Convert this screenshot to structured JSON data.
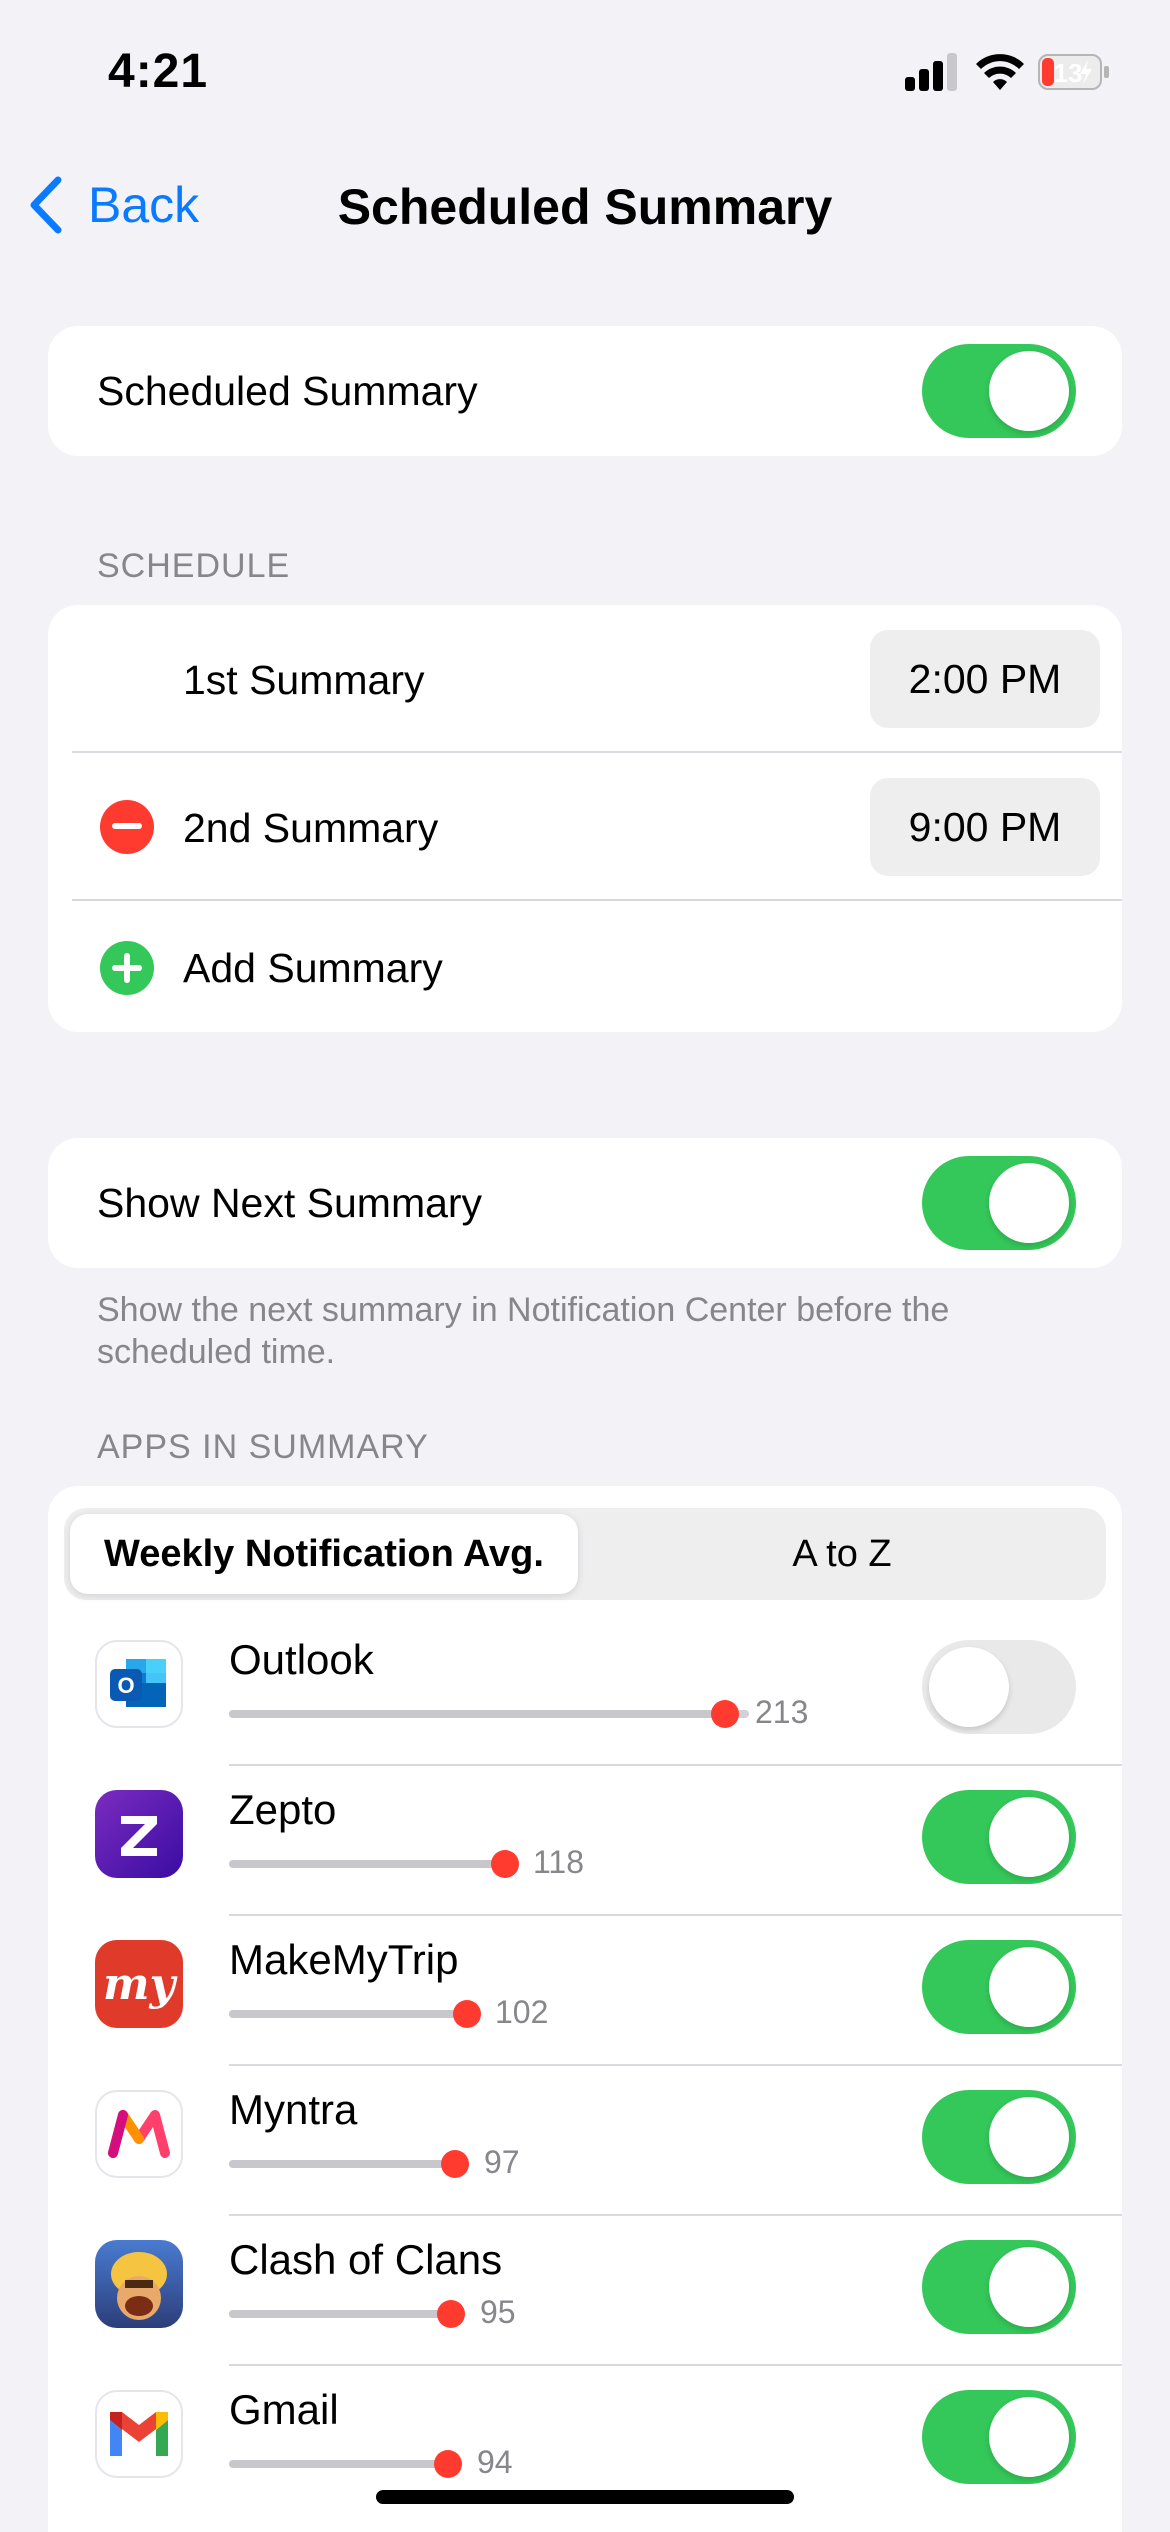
{
  "status_bar": {
    "time": "4:21",
    "battery_level": "13"
  },
  "nav": {
    "back_label": "Back",
    "title": "Scheduled Summary"
  },
  "scheduled_summary": {
    "label": "Scheduled Summary",
    "enabled": true
  },
  "schedule": {
    "header": "SCHEDULE",
    "first": {
      "label": "1st Summary",
      "time": "2:00 PM"
    },
    "second": {
      "label": "2nd Summary",
      "time": "9:00 PM"
    },
    "add_label": "Add Summary"
  },
  "show_next": {
    "label": "Show Next Summary",
    "enabled": true,
    "footer": "Show the next summary in Notification Center before the scheduled time."
  },
  "apps": {
    "header": "APPS IN SUMMARY",
    "segments": {
      "active": "Weekly Notification Avg.",
      "inactive": "A to Z"
    },
    "list": [
      {
        "name": "Outlook",
        "count": "213",
        "enabled": false
      },
      {
        "name": "Zepto",
        "count": "118",
        "enabled": true
      },
      {
        "name": "MakeMyTrip",
        "count": "102",
        "enabled": true
      },
      {
        "name": "Myntra",
        "count": "97",
        "enabled": true
      },
      {
        "name": "Clash of Clans",
        "count": "95",
        "enabled": true
      },
      {
        "name": "Gmail",
        "count": "94",
        "enabled": true
      }
    ]
  },
  "colors": {
    "accent": "#0a7aff",
    "toggle_on": "#34c759",
    "destructive": "#ff3b30"
  }
}
